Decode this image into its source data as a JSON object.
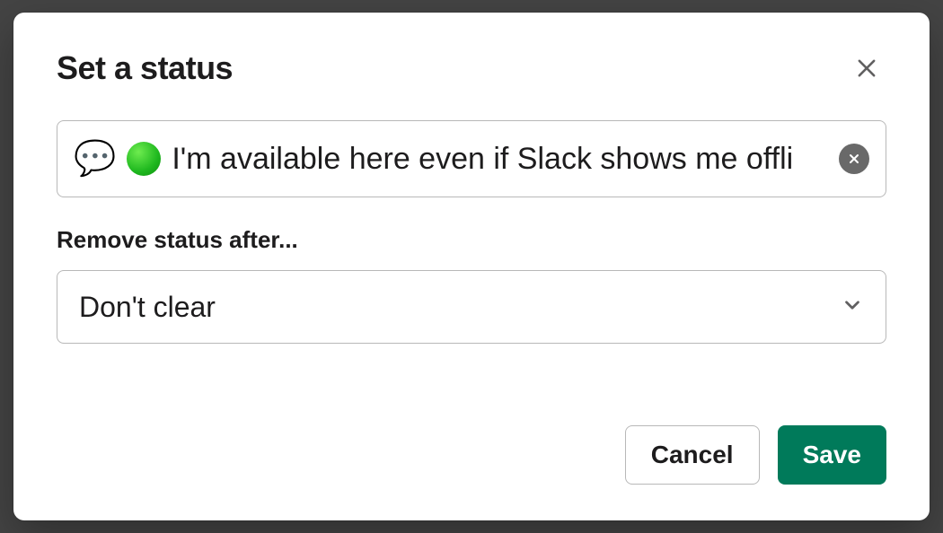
{
  "modal": {
    "title": "Set a status",
    "status_emoji_bubble": "💬",
    "status_text": "I'm available here even if Slack shows me offli",
    "remove_label": "Remove status after...",
    "clear_option": "Don't clear",
    "cancel_label": "Cancel",
    "save_label": "Save"
  }
}
